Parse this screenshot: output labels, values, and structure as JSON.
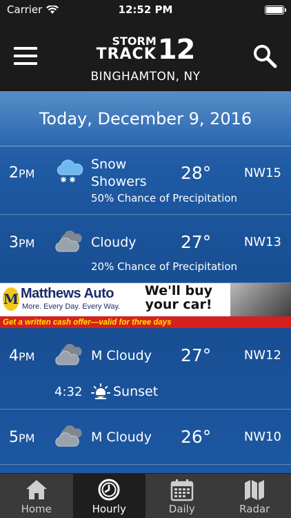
{
  "status_bar": {
    "carrier": "Carrier",
    "time": "12:52 PM",
    "battery_level": 1.0
  },
  "header": {
    "logo_storm": "STORM",
    "logo_track": "TRACK",
    "logo_number": "12",
    "location": "BINGHAMTON, NY"
  },
  "forecast": {
    "date": "Today, December 9, 2016",
    "hours": [
      {
        "hour": "2",
        "ampm": "PM",
        "icon": "snow-showers-icon",
        "condition_line1": "Snow",
        "condition_line2": "Showers",
        "temp": "28°",
        "wind": "NW15",
        "precip": "50% Chance of Precipitation"
      },
      {
        "hour": "3",
        "ampm": "PM",
        "icon": "cloudy-icon",
        "condition": "Cloudy",
        "temp": "27°",
        "wind": "NW13",
        "precip": "20% Chance of Precipitation"
      },
      {
        "hour": "4",
        "ampm": "PM",
        "icon": "cloudy-icon",
        "condition": "M Cloudy",
        "temp": "27°",
        "wind": "NW12",
        "sunset_time": "4:32",
        "sunset_label": "Sunset"
      },
      {
        "hour": "5",
        "ampm": "PM",
        "icon": "cloudy-icon",
        "condition": "M Cloudy",
        "temp": "26°",
        "wind": "NW10"
      }
    ]
  },
  "ad": {
    "logo_letter": "M",
    "brand": "Matthews Auto",
    "tagline": "More. Every Day. Every Way.",
    "headline_line1": "We'll buy",
    "headline_line2": "your car!",
    "bottom": "Get a written cash offer—valid for three days"
  },
  "tabs": [
    {
      "label": "Home",
      "icon": "home-icon",
      "active": false
    },
    {
      "label": "Hourly",
      "icon": "clock-icon",
      "active": true
    },
    {
      "label": "Daily",
      "icon": "calendar-icon",
      "active": false
    },
    {
      "label": "Radar",
      "icon": "map-icon",
      "active": false
    }
  ],
  "colors": {
    "header_bg": "#1b1b1b",
    "content_blue": "#1f5aa3",
    "tab_bar_bg": "#3a3a3a",
    "ad_red": "#d61f1f",
    "ad_yellow": "#ffe600"
  }
}
